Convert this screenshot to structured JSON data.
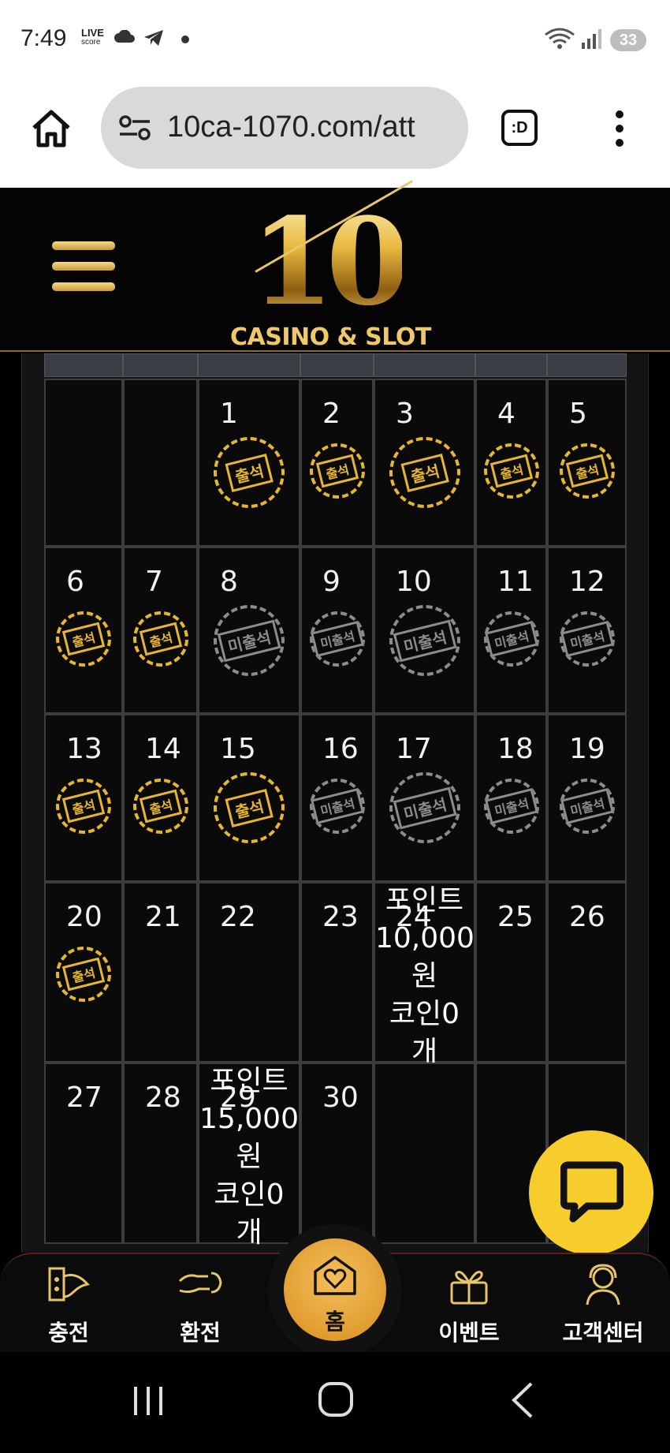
{
  "status": {
    "time": "7:49",
    "live_badge_top": "LIVE",
    "live_badge_bottom": "score",
    "battery": "33"
  },
  "browser": {
    "url": "10ca-1070.com/att"
  },
  "site": {
    "logo_number": "10",
    "logo_subtitle": "CASINO & SLOT"
  },
  "calendar": {
    "attended_label": "출석",
    "absent_label": "미출석",
    "rows": [
      [
        {
          "day": "",
          "stamp": ""
        },
        {
          "day": "",
          "stamp": ""
        },
        {
          "day": "1",
          "stamp": "attended"
        },
        {
          "day": "2",
          "stamp": "attended"
        },
        {
          "day": "3",
          "stamp": "attended"
        },
        {
          "day": "4",
          "stamp": "attended"
        },
        {
          "day": "5",
          "stamp": "attended"
        }
      ],
      [
        {
          "day": "6",
          "stamp": "attended"
        },
        {
          "day": "7",
          "stamp": "attended"
        },
        {
          "day": "8",
          "stamp": "absent"
        },
        {
          "day": "9",
          "stamp": "absent"
        },
        {
          "day": "10",
          "stamp": "absent"
        },
        {
          "day": "11",
          "stamp": "absent"
        },
        {
          "day": "12",
          "stamp": "absent"
        }
      ],
      [
        {
          "day": "13",
          "stamp": "attended"
        },
        {
          "day": "14",
          "stamp": "attended"
        },
        {
          "day": "15",
          "stamp": "attended"
        },
        {
          "day": "16",
          "stamp": "absent"
        },
        {
          "day": "17",
          "stamp": "absent"
        },
        {
          "day": "18",
          "stamp": "absent"
        },
        {
          "day": "19",
          "stamp": "absent"
        }
      ],
      [
        {
          "day": "20",
          "stamp": "attended"
        },
        {
          "day": "21",
          "stamp": ""
        },
        {
          "day": "22",
          "stamp": ""
        },
        {
          "day": "23",
          "stamp": ""
        },
        {
          "day": "24",
          "stamp": "",
          "reward": [
            "포인트",
            "10,000",
            "원",
            "코인0",
            "개"
          ]
        },
        {
          "day": "25",
          "stamp": ""
        },
        {
          "day": "26",
          "stamp": ""
        }
      ],
      [
        {
          "day": "27",
          "stamp": ""
        },
        {
          "day": "28",
          "stamp": ""
        },
        {
          "day": "29",
          "stamp": "",
          "reward": [
            "포인트",
            "15,000",
            "원",
            "코인0",
            "개"
          ]
        },
        {
          "day": "30",
          "stamp": ""
        },
        {
          "day": "",
          "stamp": ""
        },
        {
          "day": "",
          "stamp": ""
        },
        {
          "day": "",
          "stamp": ""
        }
      ]
    ]
  },
  "bottom_nav": {
    "charge": "충전",
    "exchange": "환전",
    "home": "홈",
    "event": "이벤트",
    "support": "고객센터"
  }
}
